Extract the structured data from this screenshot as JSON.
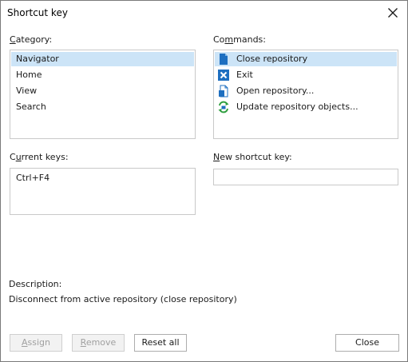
{
  "window": {
    "title": "Shortcut key",
    "close_glyph": "✕"
  },
  "category": {
    "label": "Category:",
    "items": [
      {
        "label": "Navigator",
        "selected": true
      },
      {
        "label": "Home",
        "selected": false
      },
      {
        "label": "View",
        "selected": false
      },
      {
        "label": "Search",
        "selected": false
      }
    ]
  },
  "commands": {
    "label": "Commands:",
    "items": [
      {
        "label": "Close repository",
        "icon": "close-repository-icon",
        "selected": true
      },
      {
        "label": "Exit",
        "icon": "exit-icon",
        "selected": false
      },
      {
        "label": "Open repository...",
        "icon": "open-repository-icon",
        "selected": false
      },
      {
        "label": "Update repository objects...",
        "icon": "update-repository-icon",
        "selected": false
      }
    ]
  },
  "current_keys": {
    "label": "Current keys:",
    "items": [
      "Ctrl+F4"
    ]
  },
  "new_shortcut": {
    "label": "New shortcut key:",
    "value": ""
  },
  "description": {
    "label": "Description:",
    "text": "Disconnect from active repository (close repository)"
  },
  "buttons": {
    "assign": "Assign",
    "remove": "Remove",
    "reset_all": "Reset all",
    "close": "Close"
  },
  "colors": {
    "selection": "#cce4f7",
    "icon_blue": "#1e6fc0",
    "icon_green": "#2e9e3e"
  }
}
